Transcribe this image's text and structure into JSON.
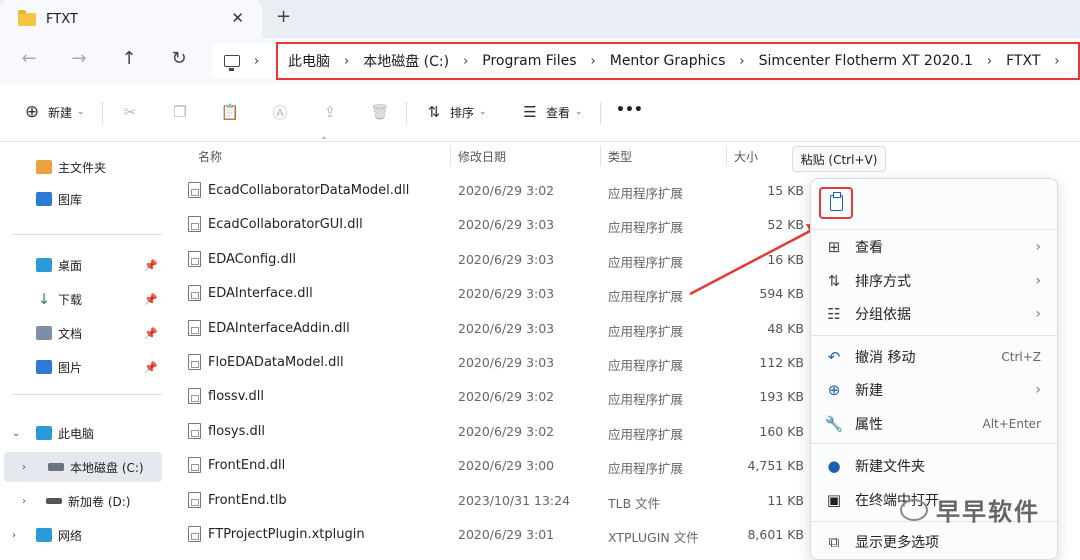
{
  "tab": {
    "title": "FTXT",
    "close": "✕",
    "new_tab": "+"
  },
  "nav": {
    "back": "←",
    "forward": "→",
    "up": "↑",
    "refresh": "↻"
  },
  "breadcrumb": [
    "此电脑",
    "本地磁盘 (C:)",
    "Program Files",
    "Mentor Graphics",
    "Simcenter Flotherm XT 2020.1",
    "FTXT"
  ],
  "breadcrumb_sep": "›",
  "toolbar": {
    "new": "新建",
    "sort": "排序",
    "view": "查看",
    "more": "•••"
  },
  "sidebar": {
    "home": "主文件夹",
    "gallery": "图库",
    "desktop": "桌面",
    "downloads": "下载",
    "documents": "文档",
    "pictures": "图片",
    "this_pc": "此电脑",
    "local_disk": "本地磁盘 (C:)",
    "new_volume": "新加卷 (D:)",
    "network": "网络"
  },
  "columns": {
    "name": "名称",
    "modified": "修改日期",
    "type": "类型",
    "size": "大小"
  },
  "files": [
    {
      "name": "EcadCollaboratorDataModel.dll",
      "date": "2020/6/29 3:02",
      "type": "应用程序扩展",
      "size": "15 KB"
    },
    {
      "name": "EcadCollaboratorGUI.dll",
      "date": "2020/6/29 3:03",
      "type": "应用程序扩展",
      "size": "52 KB"
    },
    {
      "name": "EDAConfig.dll",
      "date": "2020/6/29 3:03",
      "type": "应用程序扩展",
      "size": "16 KB"
    },
    {
      "name": "EDAInterface.dll",
      "date": "2020/6/29 3:03",
      "type": "应用程序扩展",
      "size": "594 KB"
    },
    {
      "name": "EDAInterfaceAddin.dll",
      "date": "2020/6/29 3:03",
      "type": "应用程序扩展",
      "size": "48 KB"
    },
    {
      "name": "FloEDADataModel.dll",
      "date": "2020/6/29 3:03",
      "type": "应用程序扩展",
      "size": "112 KB"
    },
    {
      "name": "flossv.dll",
      "date": "2020/6/29 3:02",
      "type": "应用程序扩展",
      "size": "193 KB"
    },
    {
      "name": "flosys.dll",
      "date": "2020/6/29 3:02",
      "type": "应用程序扩展",
      "size": "160 KB"
    },
    {
      "name": "FrontEnd.dll",
      "date": "2020/6/29 3:00",
      "type": "应用程序扩展",
      "size": "4,751 KB"
    },
    {
      "name": "FrontEnd.tlb",
      "date": "2023/10/31 13:24",
      "type": "TLB 文件",
      "size": "11 KB"
    },
    {
      "name": "FTProjectPlugin.xtplugin",
      "date": "2020/6/29 3:01",
      "type": "XTPLUGIN 文件",
      "size": "8,601 KB"
    }
  ],
  "tooltip": "粘贴 (Ctrl+V)",
  "context_menu": {
    "view": "查看",
    "sort": "排序方式",
    "group": "分组依据",
    "undo": "撤消 移动",
    "undo_shortcut": "Ctrl+Z",
    "new": "新建",
    "properties": "属性",
    "properties_shortcut": "Alt+Enter",
    "new_folder": "新建文件夹",
    "terminal": "在终端中打开",
    "more": "显示更多选项"
  },
  "watermark": "早早软件",
  "colors": {
    "highlight": "#e53935",
    "accent": "#1a5fb4"
  }
}
